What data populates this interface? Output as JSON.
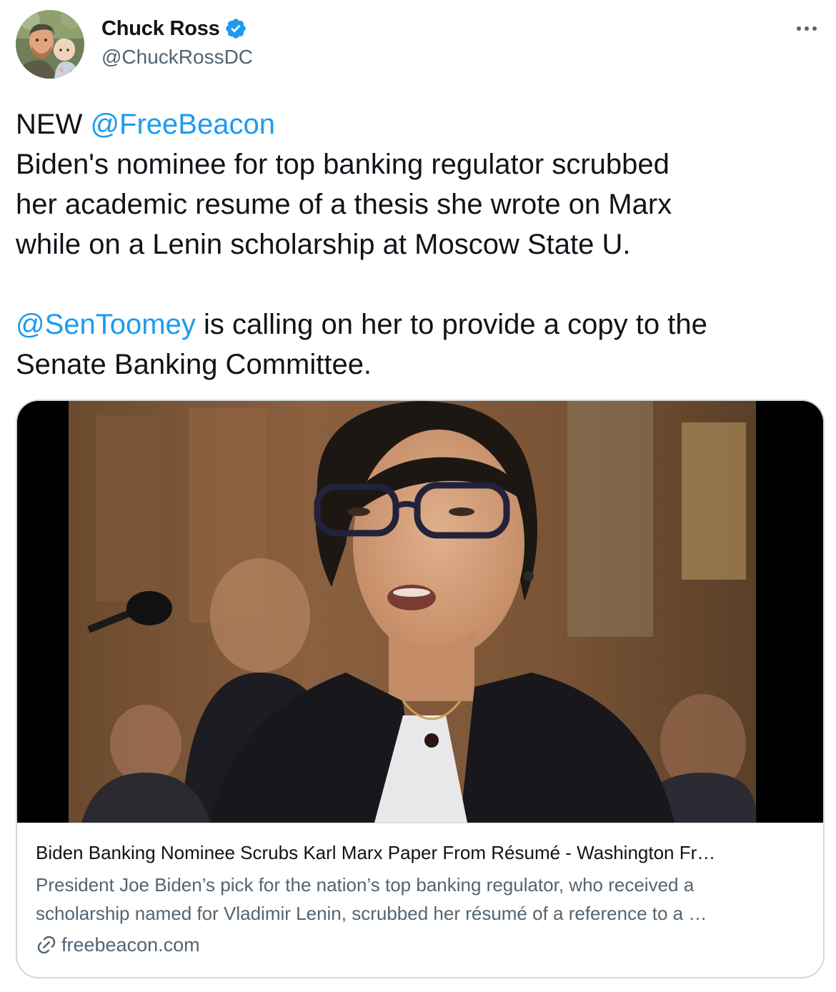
{
  "author": {
    "display_name": "Chuck Ross",
    "handle": "@ChuckRossDC",
    "verified": true,
    "verified_icon": "verified-badge-icon",
    "avatar": "avatar-man-with-child"
  },
  "more_icon": "more-horizontal-icon",
  "tweet": {
    "line1_prefix": "NEW ",
    "line1_mention": "@FreeBeacon",
    "line2": "Biden's nominee for top banking regulator scrubbed",
    "line3": "her academic resume of a thesis she wrote on Marx",
    "line4": "while on a Lenin scholarship at Moscow State U.",
    "line5_mention": "@SenToomey",
    "line5_rest": " is calling on her to provide a copy to the",
    "line6": "Senate Banking Committee."
  },
  "card": {
    "image": "photo-woman-with-glasses-at-senate-hearing",
    "title": "Biden Banking Nominee Scrubs Karl Marx Paper From Résumé - Washington Fr…",
    "description_line1": "President Joe Biden’s pick for the nation’s top banking regulator, who received a",
    "description_line2": "scholarship named for Vladimir Lenin, scrubbed her résumé of a reference to a …",
    "domain_icon": "link-icon",
    "domain": "freebeacon.com"
  },
  "colors": {
    "text": "#0f1419",
    "secondary": "#536471",
    "link": "#1d9bf0",
    "border": "#cfd9de",
    "verified": "#1d9bf0"
  }
}
